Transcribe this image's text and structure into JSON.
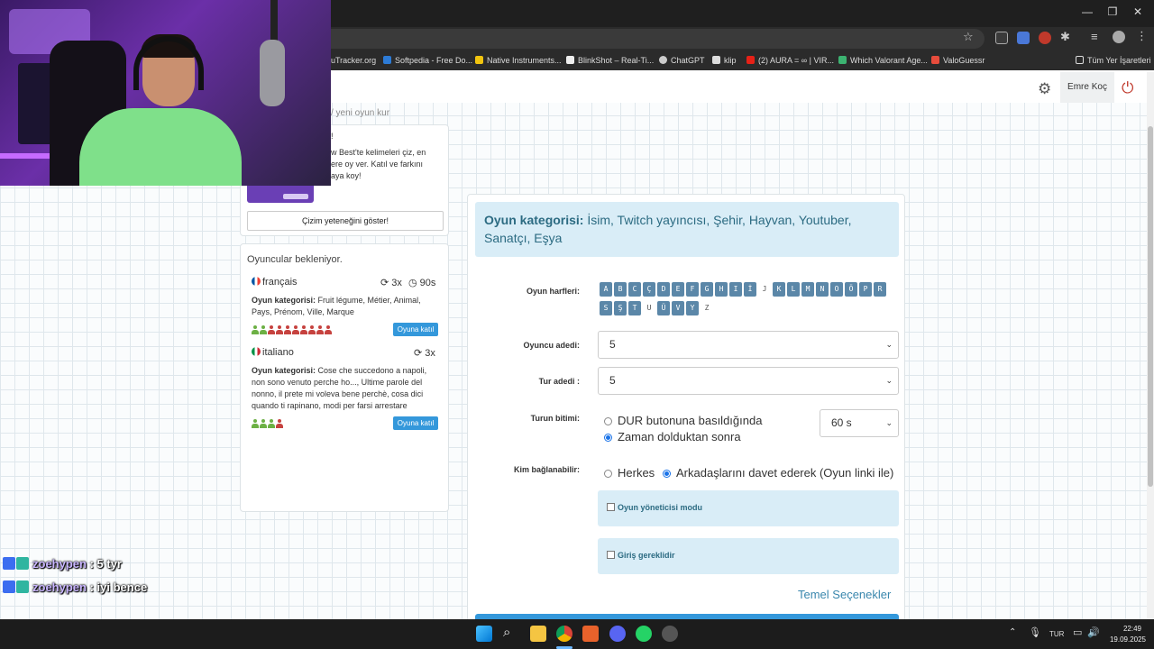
{
  "bookmarks": [
    {
      "label": "uTracker.org"
    },
    {
      "label": "Softpedia - Free Do..."
    },
    {
      "label": "Native Instruments..."
    },
    {
      "label": "BlinkShot – Real-Ti..."
    },
    {
      "label": "ChatGPT"
    },
    {
      "label": "klip"
    },
    {
      "label": "(2) AURA = ∞ | VIR..."
    },
    {
      "label": "Which Valorant Age..."
    },
    {
      "label": "ValoGuessr"
    },
    {
      "label": "Tüm Yer İşaretleri"
    }
  ],
  "header": {
    "username": "Emre Koç"
  },
  "breadcrumb": "/  yeni oyun kur",
  "promo": {
    "title_fragment": "!",
    "text": "w Best'te kelimeleri çiz, en ere oy ver. Katıl ve farkını aya koy!",
    "button": "Çizim yeteneğini göster!"
  },
  "lobby": {
    "title": "Oyuncular bekleniyor.",
    "rooms": [
      {
        "language": "français",
        "rounds": "3x",
        "time": "90s",
        "category_label": "Oyun kategorisi:",
        "categories": "Fruit légume, Métier, Animal, Pays, Prénom, Ville, Marque",
        "players_in": 2,
        "players_total": 10,
        "join": "Oyuna katıl"
      },
      {
        "language": "italiano",
        "rounds": "3x",
        "category_label": "Oyun kategorisi:",
        "categories": "Cose che succedono a napoli, non sono venuto perche ho..., Ultime parole del nonno, il prete mi voleva bene perchè, cosa dici quando ti rapinano, modi per farsi arrestare",
        "players_in": 3,
        "players_total": 4,
        "join": "Oyuna katıl"
      }
    ]
  },
  "settings": {
    "category_label": "Oyun kategorisi:",
    "categories": "İsim, Twitch yayıncısı, Şehir, Hayvan, Youtuber, Sanatçı, Eşya",
    "letters_label": "Oyun harfleri:",
    "letters_row1": [
      {
        "l": "A",
        "on": true
      },
      {
        "l": "B",
        "on": true
      },
      {
        "l": "C",
        "on": true
      },
      {
        "l": "Ç",
        "on": true
      },
      {
        "l": "D",
        "on": true
      },
      {
        "l": "E",
        "on": true
      },
      {
        "l": "F",
        "on": true
      },
      {
        "l": "G",
        "on": true
      },
      {
        "l": "H",
        "on": true
      },
      {
        "l": "I",
        "on": true
      },
      {
        "l": "İ",
        "on": true
      },
      {
        "l": "J",
        "on": false
      },
      {
        "l": "K",
        "on": true
      },
      {
        "l": "L",
        "on": true
      },
      {
        "l": "M",
        "on": true
      },
      {
        "l": "N",
        "on": true
      },
      {
        "l": "O",
        "on": true
      },
      {
        "l": "Ö",
        "on": true
      },
      {
        "l": "P",
        "on": true
      },
      {
        "l": "R",
        "on": true
      }
    ],
    "letters_row2": [
      {
        "l": "S",
        "on": true
      },
      {
        "l": "Ş",
        "on": true
      },
      {
        "l": "T",
        "on": true
      },
      {
        "l": "U",
        "on": false
      },
      {
        "l": "Ü",
        "on": true
      },
      {
        "l": "V",
        "on": true
      },
      {
        "l": "Y",
        "on": true
      },
      {
        "l": "Z",
        "on": false
      }
    ],
    "player_count_label": "Oyuncu adedi:",
    "player_count": "5",
    "round_count_label": "Tur adedi :",
    "round_count": "5",
    "round_end_label": "Turun bitimi:",
    "round_end_options": [
      "DUR butonuna basıldığında",
      "Zaman dolduktan sonra"
    ],
    "round_end_selected": 1,
    "round_time": "60 s",
    "who_label": "Kim bağlanabilir:",
    "who_options": [
      "Herkes",
      "Arkadaşlarını davet ederek (Oyun linki ile)"
    ],
    "who_selected": 1,
    "admin_mode": "Oyun yöneticisi modu",
    "login_required": "Giriş gereklidir",
    "basic_options": "Temel Seçenekler"
  },
  "chat": [
    {
      "nick": "zoehypen",
      "sep": " : ",
      "msg": "5 tyr"
    },
    {
      "nick": "zoehypen",
      "sep": " : ",
      "msg": "iyi bence"
    }
  ],
  "taskbar": {
    "lang": "TUR",
    "time": "22:49",
    "date": "19.09.2025"
  },
  "colors": {
    "accent": "#3498db",
    "letter": "#5b87a8",
    "info_bg": "#d9edf7",
    "info_text": "#2c6b82"
  }
}
